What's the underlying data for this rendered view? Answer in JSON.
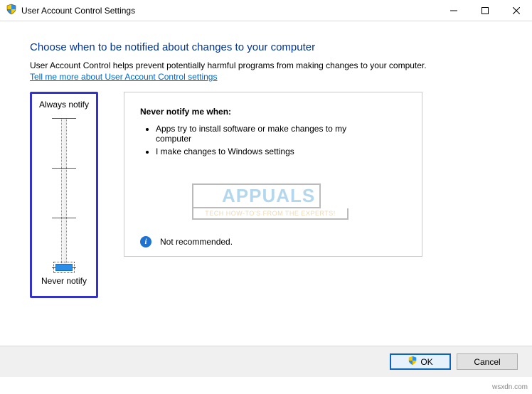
{
  "window": {
    "title": "User Account Control Settings"
  },
  "heading": "Choose when to be notified about changes to your computer",
  "description": "User Account Control helps prevent potentially harmful programs from making changes to your computer.",
  "link": "Tell me more about User Account Control settings",
  "slider": {
    "top_label": "Always notify",
    "bottom_label": "Never notify"
  },
  "panel": {
    "title": "Never notify me when:",
    "items": [
      "Apps try to install software or make changes to my computer",
      "I make changes to Windows settings"
    ],
    "recommendation": "Not recommended."
  },
  "buttons": {
    "ok": "OK",
    "cancel": "Cancel"
  },
  "watermark": {
    "brand": "APPUALS",
    "tag": "TECH HOW-TO'S FROM THE EXPERTS!"
  },
  "attribution": "wsxdn.com"
}
